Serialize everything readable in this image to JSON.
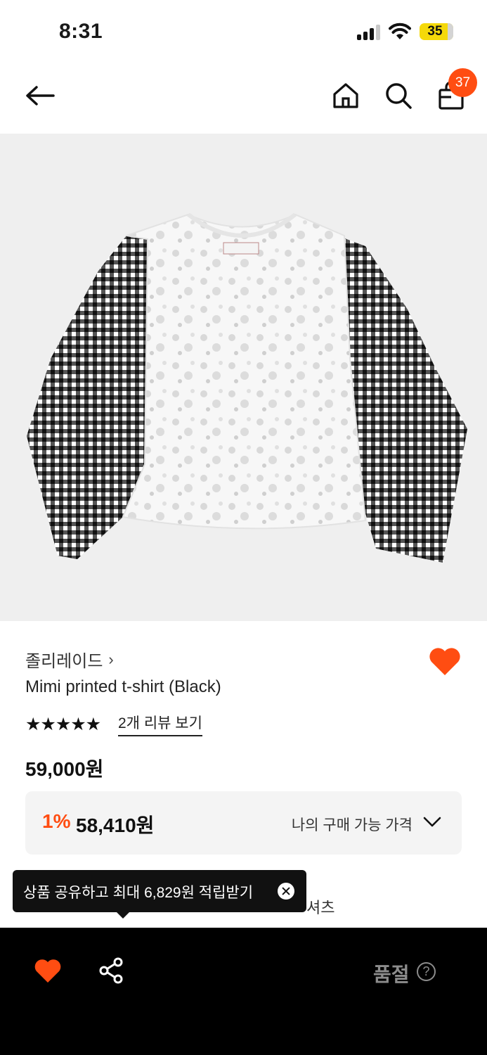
{
  "status_bar": {
    "time": "8:31",
    "battery": "35"
  },
  "header": {
    "cart_count": "37"
  },
  "product": {
    "brand": "졸리레이드",
    "brand_chevron": "›",
    "name": "Mimi printed t-shirt (Black)",
    "rating": 4.5,
    "review_link": "2개 리뷰 보기",
    "price": "59,000원",
    "discount_rate": "1%",
    "discount_price": "58,410원",
    "my_price_label": "나의 구매 가능 가격"
  },
  "behind_text": "셔츠",
  "tooltip": {
    "text": "상품 공유하고 최대 6,829원 적립받기"
  },
  "bottom_bar": {
    "soldout_label": "품절",
    "help_symbol": "?"
  },
  "colors": {
    "accent": "#ff4d12",
    "bottom_bar": "#000000",
    "soldout": "#8c8c8c"
  },
  "icons": [
    "back-arrow-icon",
    "home-icon",
    "search-icon",
    "cart-icon",
    "heart-icon",
    "share-icon",
    "chevron-down-icon",
    "close-icon",
    "help-icon"
  ]
}
